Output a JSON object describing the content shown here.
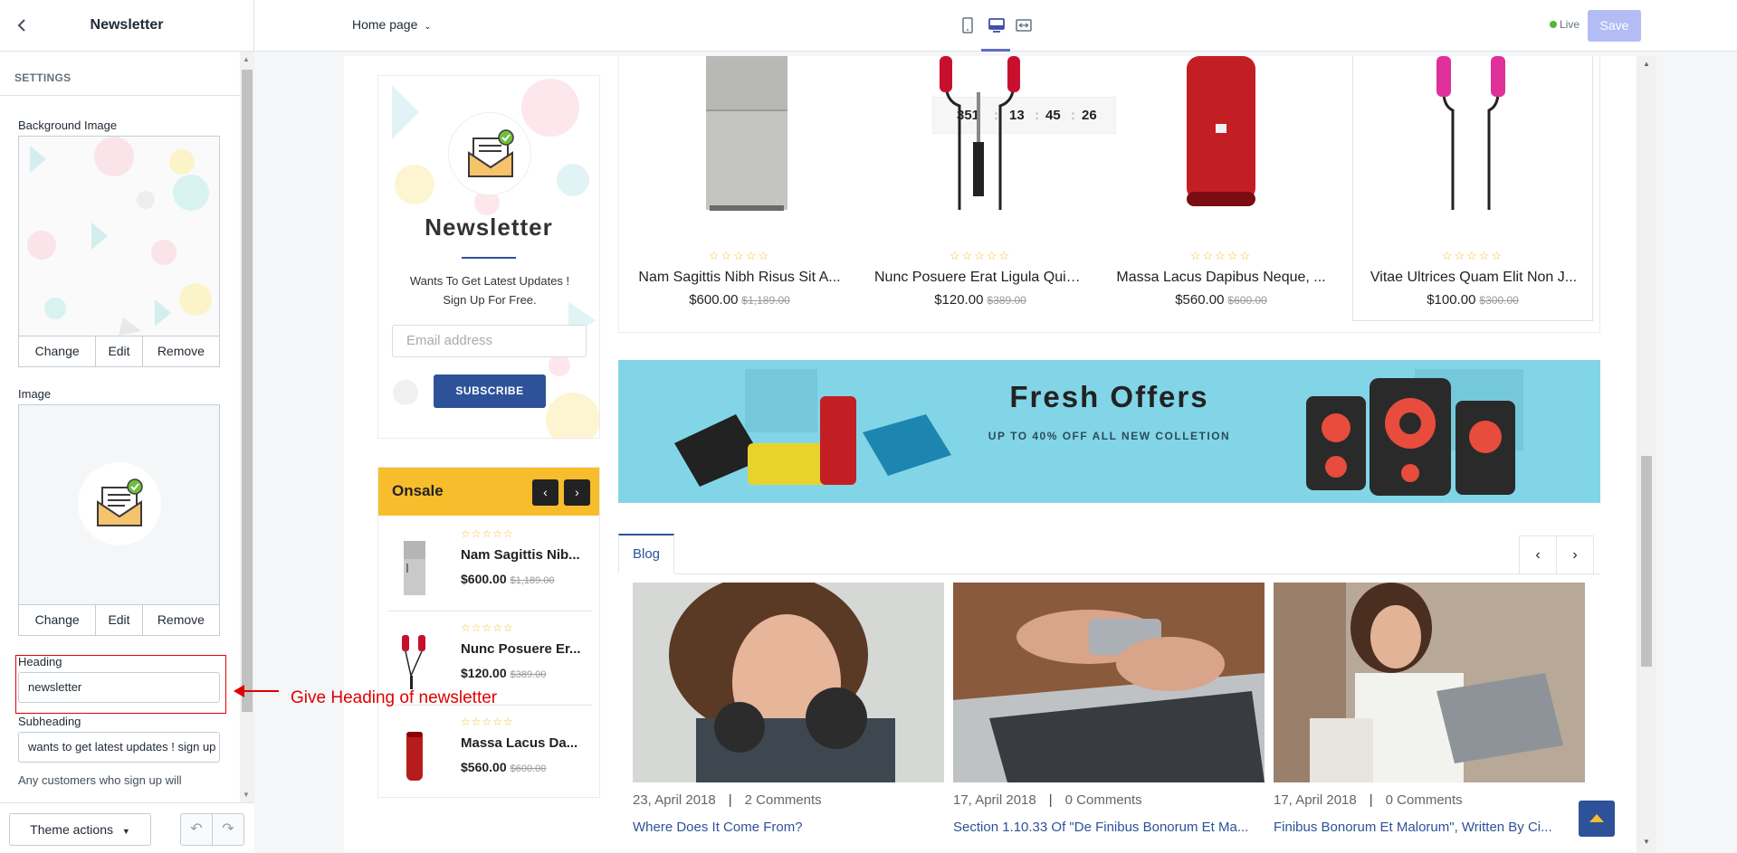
{
  "sidebar": {
    "title": "Newsletter",
    "section": "SETTINGS",
    "background_image": {
      "label": "Background Image",
      "change": "Change",
      "edit": "Edit",
      "remove": "Remove"
    },
    "image": {
      "label": "Image",
      "change": "Change",
      "edit": "Edit",
      "remove": "Remove"
    },
    "heading": {
      "label": "Heading",
      "value": "newsletter"
    },
    "subheading": {
      "label": "Subheading",
      "value": "wants to get latest updates ! sign up for free."
    },
    "more_text": "Any customers who sign up will",
    "footer": {
      "theme_actions": "Theme actions"
    }
  },
  "topbar": {
    "page_select": "Home page",
    "live_label": "Live",
    "save_label": "Save"
  },
  "preview": {
    "newsletter": {
      "title": "Newsletter",
      "subtitle_line1": "Wants To Get Latest Updates !",
      "subtitle_line2": "Sign Up For Free.",
      "email_placeholder": "Email address",
      "subscribe": "SUBSCRIBE"
    },
    "countdown": {
      "days": "351",
      "hours": "13",
      "minutes": "45",
      "seconds": "26"
    },
    "products": [
      {
        "name": "Nam Sagittis Nibh Risus Sit A...",
        "price": "$600.00",
        "old_price": "$1,189.00"
      },
      {
        "name": "Nunc Posuere Erat Ligula Quis ...",
        "price": "$120.00",
        "old_price": "$389.00"
      },
      {
        "name": "Massa Lacus Dapibus Neque, ...",
        "price": "$560.00",
        "old_price": "$600.00"
      },
      {
        "name": "Vitae Ultrices Quam Elit Non J...",
        "price": "$100.00",
        "old_price": "$300.00"
      }
    ],
    "onsale": {
      "title": "Onsale",
      "items": [
        {
          "name": "Nam Sagittis Nib...",
          "price": "$600.00",
          "old_price": "$1,189.00"
        },
        {
          "name": "Nunc Posuere Er...",
          "price": "$120.00",
          "old_price": "$389.00"
        },
        {
          "name": "Massa Lacus Da...",
          "price": "$560.00",
          "old_price": "$600.00"
        }
      ]
    },
    "banner": {
      "title": "Fresh Offers",
      "subtitle": "UP TO 40% OFF ALL NEW COLLETION"
    },
    "blog": {
      "tab": "Blog",
      "posts": [
        {
          "date": "23, April 2018",
          "comments": "2 Comments",
          "title": "Where Does It Come From?"
        },
        {
          "date": "17, April 2018",
          "comments": "0 Comments",
          "title": "Section 1.10.33 Of \"De Finibus Bonorum Et Ma..."
        },
        {
          "date": "17, April 2018",
          "comments": "0 Comments",
          "title": "Finibus Bonorum Et Malorum\", Written By Ci..."
        }
      ]
    }
  },
  "annotation": {
    "text": "Give Heading of newsletter"
  },
  "colors": {
    "accent": "#2d5299",
    "onsale": "#f7bd2d",
    "annotation": "#e00000",
    "save": "#b3bcf5"
  }
}
